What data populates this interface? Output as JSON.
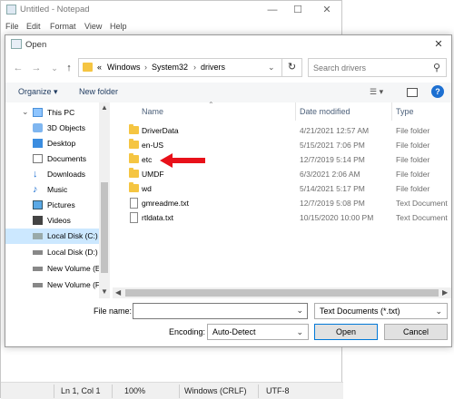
{
  "notepad": {
    "title": "Untitled - Notepad",
    "menu": [
      "File",
      "Edit",
      "Format",
      "View",
      "Help"
    ],
    "status": [
      "Ln 1, Col 1",
      "100%",
      "Windows (CRLF)",
      "UTF-8"
    ]
  },
  "dialog": {
    "title": "Open",
    "breadcrumb": [
      "«",
      "Windows",
      "System32",
      "drivers"
    ],
    "search_placeholder": "Search drivers",
    "toolbar": {
      "organize": "Organize",
      "new_folder": "New folder"
    },
    "nav_items": [
      {
        "label": "This PC",
        "icon": "computer-icon"
      },
      {
        "label": "3D Objects",
        "icon": "cube-icon"
      },
      {
        "label": "Desktop",
        "icon": "desktop-icon"
      },
      {
        "label": "Documents",
        "icon": "document-icon"
      },
      {
        "label": "Downloads",
        "icon": "download-icon"
      },
      {
        "label": "Music",
        "icon": "music-icon"
      },
      {
        "label": "Pictures",
        "icon": "picture-icon"
      },
      {
        "label": "Videos",
        "icon": "video-icon"
      },
      {
        "label": "Local Disk (C:)",
        "icon": "drive-icon"
      },
      {
        "label": "Local Disk (D:)",
        "icon": "drive-icon"
      },
      {
        "label": "New Volume (E",
        "icon": "drive-icon"
      },
      {
        "label": "New Volume (F",
        "icon": "drive-icon"
      }
    ],
    "columns": [
      "Name",
      "Date modified",
      "Type"
    ],
    "files": [
      {
        "name": "DriverData",
        "date": "4/21/2021 12:57 AM",
        "type": "File folder",
        "kind": "folder"
      },
      {
        "name": "en-US",
        "date": "5/15/2021 7:06 PM",
        "type": "File folder",
        "kind": "folder"
      },
      {
        "name": "etc",
        "date": "12/7/2019 5:14 PM",
        "type": "File folder",
        "kind": "folder"
      },
      {
        "name": "UMDF",
        "date": "6/3/2021 2:06 AM",
        "type": "File folder",
        "kind": "folder"
      },
      {
        "name": "wd",
        "date": "5/14/2021 5:17 PM",
        "type": "File folder",
        "kind": "folder"
      },
      {
        "name": "gmreadme.txt",
        "date": "12/7/2019 5:08 PM",
        "type": "Text Document",
        "kind": "doc"
      },
      {
        "name": "rtldata.txt",
        "date": "10/15/2020 10:00 PM",
        "type": "Text Document",
        "kind": "doc"
      }
    ],
    "file_name_label": "File name:",
    "file_name_value": "",
    "file_type": "Text Documents (*.txt)",
    "encoding_label": "Encoding:",
    "encoding": "Auto-Detect",
    "open_label": "Open",
    "cancel_label": "Cancel",
    "accent": "#e8111a"
  }
}
